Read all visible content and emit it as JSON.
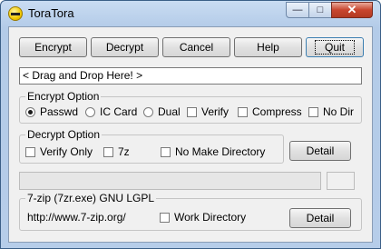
{
  "window": {
    "title": "ToraTora",
    "controls": {
      "minimize": "—",
      "maximize": "□",
      "close": "✕"
    }
  },
  "toolbar": {
    "encrypt": "Encrypt",
    "decrypt": "Decrypt",
    "cancel": "Cancel",
    "help": "Help",
    "quit": "Quit"
  },
  "drop_zone": {
    "text": "< Drag and Drop Here! >"
  },
  "encrypt_option": {
    "title": "Encrypt Option",
    "mode_options": [
      {
        "label": "Passwd",
        "selected": true
      },
      {
        "label": "IC Card",
        "selected": false
      },
      {
        "label": "Dual",
        "selected": false
      }
    ],
    "checkboxes": [
      {
        "label": "Verify",
        "checked": false
      },
      {
        "label": "Compress",
        "checked": false
      },
      {
        "label": "No Dir",
        "checked": false
      }
    ]
  },
  "decrypt_option": {
    "title": "Decrypt Option",
    "checkboxes": [
      {
        "label": "Verify Only",
        "checked": false
      },
      {
        "label": "7z",
        "checked": false
      },
      {
        "label": "No Make Directory",
        "checked": false
      }
    ],
    "detail_button": "Detail"
  },
  "progress": {
    "value": 0
  },
  "sevenzip": {
    "title": "7-zip (7zr.exe)  GNU LGPL",
    "url": "http://www.7-zip.org/",
    "work_directory": {
      "label": "Work Directory",
      "checked": false
    },
    "detail_button": "Detail"
  },
  "colors": {
    "title_bar": "#b6cde9",
    "client_bg": "#f0f0f0",
    "close_button": "#c8452e"
  }
}
